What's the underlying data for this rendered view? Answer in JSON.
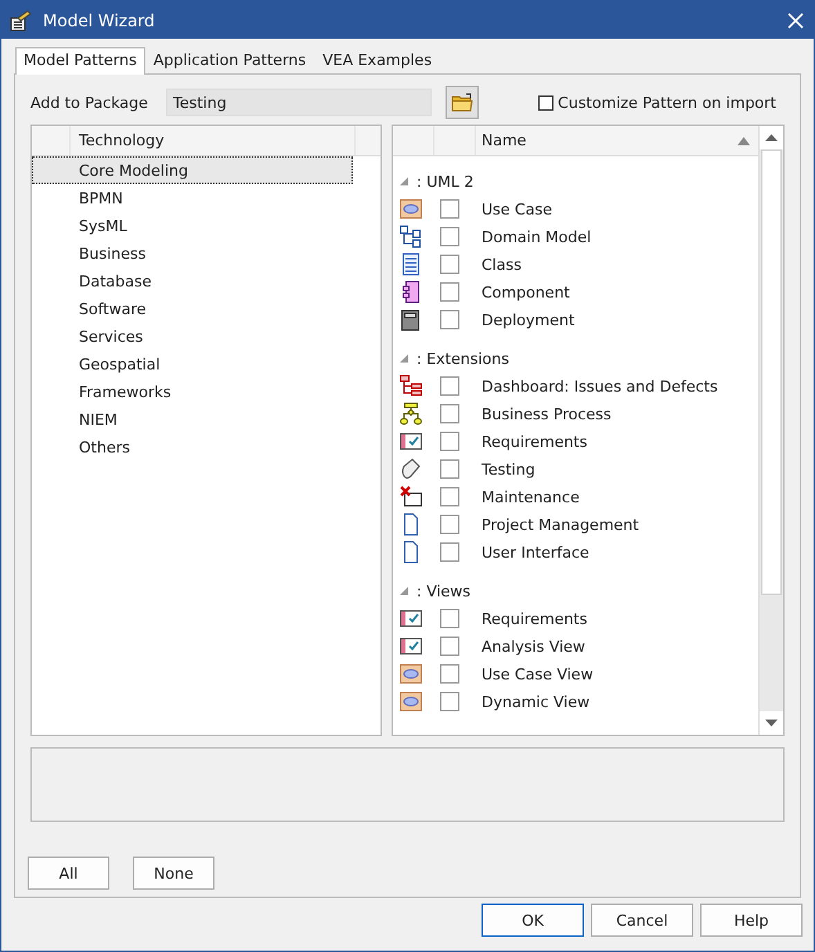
{
  "window": {
    "title": "Model Wizard"
  },
  "tabs": [
    {
      "label": "Model Patterns",
      "selected": true
    },
    {
      "label": "Application Patterns",
      "selected": false
    },
    {
      "label": "VEA Examples",
      "selected": false
    }
  ],
  "add_to_package": {
    "label": "Add to Package",
    "value": "Testing"
  },
  "customize": {
    "label": "Customize Pattern on import",
    "checked": false
  },
  "technology": {
    "column": "Technology",
    "items": [
      {
        "label": "Core Modeling",
        "selected": true
      },
      {
        "label": "BPMN",
        "selected": false
      },
      {
        "label": "SysML",
        "selected": false
      },
      {
        "label": "Business",
        "selected": false
      },
      {
        "label": "Database",
        "selected": false
      },
      {
        "label": "Software",
        "selected": false
      },
      {
        "label": "Services",
        "selected": false
      },
      {
        "label": "Geospatial",
        "selected": false
      },
      {
        "label": "Frameworks",
        "selected": false
      },
      {
        "label": "NIEM",
        "selected": false
      },
      {
        "label": "Others",
        "selected": false
      }
    ]
  },
  "patterns": {
    "column": "Name",
    "groups": [
      {
        "title": ": UML 2",
        "expanded": true,
        "items": [
          {
            "name": "Use Case",
            "kind": "usecase",
            "checked": false
          },
          {
            "name": "Domain Model",
            "kind": "tree",
            "checked": false
          },
          {
            "name": "Class",
            "kind": "class",
            "checked": false
          },
          {
            "name": "Component",
            "kind": "component",
            "checked": false
          },
          {
            "name": "Deployment",
            "kind": "deployment",
            "checked": false
          }
        ]
      },
      {
        "title": ": Extensions",
        "expanded": true,
        "items": [
          {
            "name": "Dashboard: Issues and Defects",
            "kind": "dashboard",
            "checked": false
          },
          {
            "name": "Business Process",
            "kind": "process",
            "checked": false
          },
          {
            "name": "Requirements",
            "kind": "requirement",
            "checked": false
          },
          {
            "name": "Testing",
            "kind": "testing",
            "checked": false
          },
          {
            "name": "Maintenance",
            "kind": "maintenance",
            "checked": false
          },
          {
            "name": "Project Management",
            "kind": "document",
            "checked": false
          },
          {
            "name": "User Interface",
            "kind": "document",
            "checked": false
          }
        ]
      },
      {
        "title": ": Views",
        "expanded": true,
        "items": [
          {
            "name": "Requirements",
            "kind": "requirement",
            "checked": false
          },
          {
            "name": "Analysis View",
            "kind": "requirement",
            "checked": false
          },
          {
            "name": "Use Case View",
            "kind": "usecase",
            "checked": false
          },
          {
            "name": "Dynamic View",
            "kind": "usecase",
            "checked": false
          }
        ]
      }
    ]
  },
  "selection_buttons": [
    "All",
    "None"
  ],
  "buttons": [
    {
      "label": "OK",
      "default": true
    },
    {
      "label": "Cancel",
      "default": false
    },
    {
      "label": "Help",
      "default": false
    }
  ]
}
